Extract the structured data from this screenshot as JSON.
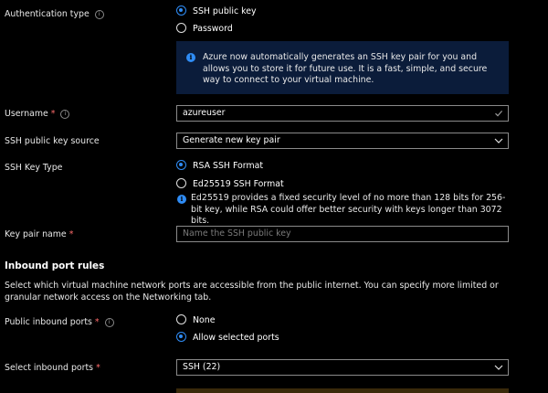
{
  "auth": {
    "label": "Authentication type",
    "options": [
      "SSH public key",
      "Password"
    ],
    "selected": "SSH public key",
    "notice": "Azure now automatically generates an SSH key pair for you and allows you to store it for future use. It is a fast, simple, and secure way to connect to your virtual machine."
  },
  "username": {
    "label": "Username",
    "value": "azureuser"
  },
  "key_source": {
    "label": "SSH public key source",
    "value": "Generate new key pair"
  },
  "key_type": {
    "label": "SSH Key Type",
    "options": [
      "RSA SSH Format",
      "Ed25519 SSH Format"
    ],
    "selected": "RSA SSH Format",
    "hint": "Ed25519 provides a fixed security level of no more than 128 bits for 256-bit key, while RSA could offer better security with keys longer than 3072 bits."
  },
  "key_pair_name": {
    "label": "Key pair name",
    "placeholder": "Name the SSH public key"
  },
  "inbound": {
    "heading": "Inbound port rules",
    "description": "Select which virtual machine network ports are accessible from the public internet. You can specify more limited or granular network access on the Networking tab.",
    "public_ports_label": "Public inbound ports",
    "options": [
      "None",
      "Allow selected ports"
    ],
    "selected": "Allow selected ports",
    "select_ports_label": "Select inbound ports",
    "select_ports_value": "SSH (22)"
  },
  "colors": {
    "accent": "#2f8cf5",
    "required": "#ff6b6b",
    "notice_bg": "#0b1c3a"
  }
}
